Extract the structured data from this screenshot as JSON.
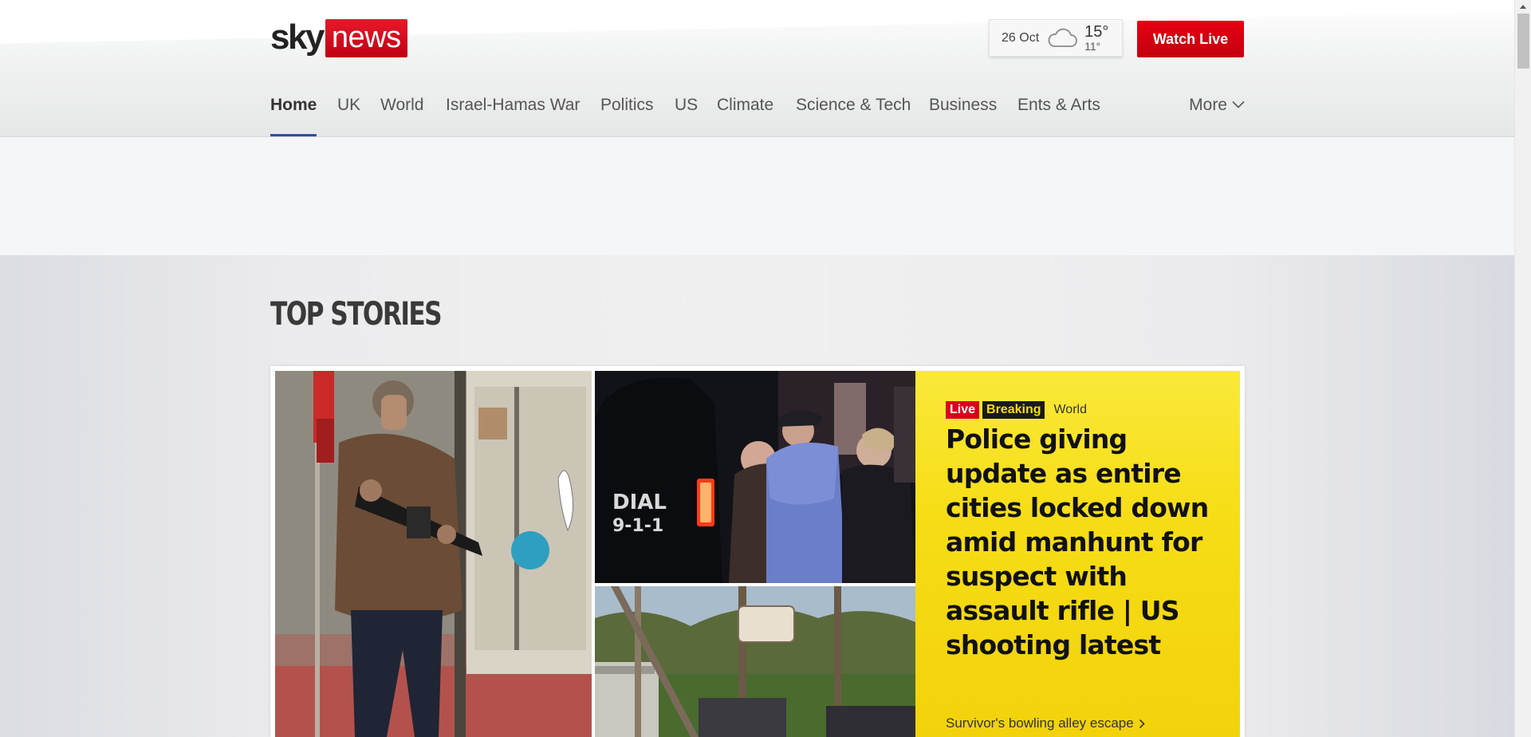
{
  "brand": {
    "logo_sky": "sky",
    "logo_news": "news"
  },
  "weather": {
    "date": "26 Oct",
    "high": "15°",
    "low": "11°",
    "icon": "cloud-icon"
  },
  "header": {
    "watch_live": "Watch Live"
  },
  "nav": {
    "items": [
      {
        "label": "Home",
        "active": true
      },
      {
        "label": "UK"
      },
      {
        "label": "World"
      },
      {
        "label": "Israel-Hamas War"
      },
      {
        "label": "Politics"
      },
      {
        "label": "US"
      },
      {
        "label": "Climate"
      },
      {
        "label": "Science & Tech"
      },
      {
        "label": "Business"
      },
      {
        "label": "Ents & Arts"
      }
    ],
    "more": "More"
  },
  "section": {
    "title": "TOP STORIES"
  },
  "lead_story": {
    "tag_live": "Live",
    "tag_breaking": "Breaking",
    "category": "World",
    "headline": "Police giving update as entire cities locked down amid manhunt for suspect with assault rifle | US shooting latest",
    "related_link": "Survivor's bowling alley escape",
    "image_text_dial": "DIAL",
    "image_text_911": "9-1-1"
  },
  "colors": {
    "brand_red": "#d8001c",
    "nav_active": "#2b4fa8",
    "story_yellow": "#f6dd16"
  }
}
